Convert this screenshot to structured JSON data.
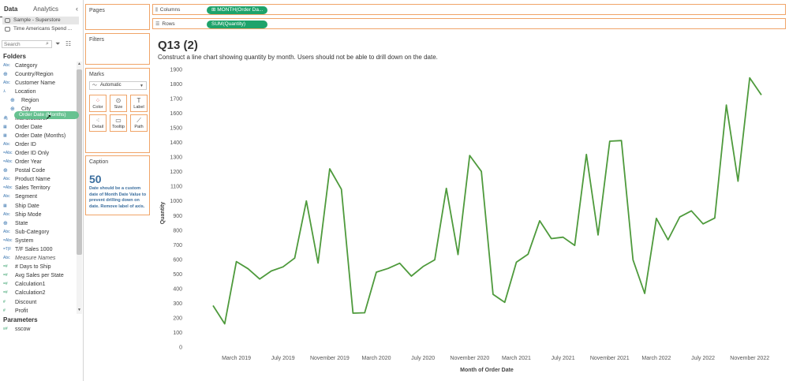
{
  "data_pane": {
    "tabs": [
      "Data",
      "Analytics"
    ],
    "datasources": [
      "Sample - Superstore",
      "Time Americans Spend ..."
    ],
    "search_placeholder": "Search",
    "folders_heading": "Folders",
    "fields": [
      {
        "name": "Category",
        "type": "Abc",
        "indent": false
      },
      {
        "name": "Country/Region",
        "type": "geo",
        "indent": false
      },
      {
        "name": "Customer Name",
        "type": "Abc",
        "indent": false
      },
      {
        "name": "Location",
        "type": "hier",
        "indent": false
      },
      {
        "name": "Region",
        "type": "geo",
        "indent": true
      },
      {
        "name": "City",
        "type": "geo",
        "indent": true
      },
      {
        "name": "Manufacturer",
        "type": "clip",
        "indent": false
      },
      {
        "name": "Order Date",
        "type": "date",
        "indent": false
      },
      {
        "name": "Order Date (Months)",
        "type": "date",
        "indent": false
      },
      {
        "name": "Order ID",
        "type": "Abc",
        "indent": false
      },
      {
        "name": "Order ID Only",
        "type": "=Abc",
        "indent": false
      },
      {
        "name": "Order Year",
        "type": "=Abc",
        "indent": false
      },
      {
        "name": "Postal Code",
        "type": "geo",
        "indent": false
      },
      {
        "name": "Product Name",
        "type": "Abc",
        "indent": false
      },
      {
        "name": "Sales Territory",
        "type": "=Abc",
        "indent": false
      },
      {
        "name": "Segment",
        "type": "Abc",
        "indent": false
      },
      {
        "name": "Ship Date",
        "type": "date",
        "indent": false
      },
      {
        "name": "Ship Mode",
        "type": "Abc",
        "indent": false
      },
      {
        "name": "State",
        "type": "geo",
        "indent": false
      },
      {
        "name": "Sub-Category",
        "type": "Abc",
        "indent": false
      },
      {
        "name": "System",
        "type": "=Abc",
        "indent": false
      },
      {
        "name": "T/F Sales 1000",
        "type": "=T|F",
        "indent": false
      },
      {
        "name": "Measure Names",
        "type": "Abc",
        "indent": false,
        "italic": true
      },
      {
        "name": "# Days to Ship",
        "type": "=#",
        "indent": false,
        "measure": true
      },
      {
        "name": "Avg Sales per State",
        "type": "=#",
        "indent": false,
        "measure": true
      },
      {
        "name": "Calculation1",
        "type": "=#",
        "indent": false,
        "measure": true
      },
      {
        "name": "Calculation2",
        "type": "=#",
        "indent": false,
        "measure": true
      },
      {
        "name": "Discount",
        "type": "#",
        "indent": false,
        "measure": true
      },
      {
        "name": "Profit",
        "type": "#",
        "indent": false,
        "measure": true
      }
    ],
    "parameters_heading": "Parameters",
    "parameters": [
      {
        "name": "sscow",
        "type": "#"
      }
    ]
  },
  "drag_pill": "Order Date (Months)",
  "cards": {
    "pages": "Pages",
    "filters": "Filters",
    "marks": "Marks",
    "marks_type": "Automatic",
    "mark_buttons": [
      "Color",
      "Size",
      "Label",
      "Detail",
      "Tooltip",
      "Path"
    ],
    "caption": "Caption",
    "caption_number": "50",
    "caption_text": "Date should be a custom date of Month Date Value to prevent drilling down on date.  Remove label of axis."
  },
  "shelves": {
    "columns_label": "Columns",
    "columns_pill": "MONTH(Order Da...",
    "rows_label": "Rows",
    "rows_pill": "SUM(Quantity)"
  },
  "viz": {
    "title": "Q13 (2)",
    "subtitle": "Construct a line chart showing quantity by month.  Users should not be able to drill down on the date."
  },
  "colors": {
    "line": "#4e9a3c",
    "pill": "#1ea36b",
    "shelf_border": "#f0a468",
    "caption": "#3b6e9e"
  },
  "chart_data": {
    "type": "line",
    "xlabel": "Month of Order Date",
    "ylabel": "Quantity",
    "ylim": [
      0,
      1900
    ],
    "yticks": [
      0,
      100,
      200,
      300,
      400,
      500,
      600,
      700,
      800,
      900,
      1000,
      1100,
      1200,
      1300,
      1400,
      1500,
      1600,
      1700,
      1800,
      1900
    ],
    "xtick_labels": [
      {
        "label": "March 2019",
        "index": 2
      },
      {
        "label": "July 2019",
        "index": 6
      },
      {
        "label": "November 2019",
        "index": 10
      },
      {
        "label": "March 2020",
        "index": 14
      },
      {
        "label": "July 2020",
        "index": 18
      },
      {
        "label": "November 2020",
        "index": 22
      },
      {
        "label": "March 2021",
        "index": 26
      },
      {
        "label": "July 2021",
        "index": 30
      },
      {
        "label": "November 2021",
        "index": 34
      },
      {
        "label": "March 2022",
        "index": 38
      },
      {
        "label": "July 2022",
        "index": 42
      },
      {
        "label": "November 2022",
        "index": 46
      }
    ],
    "series": [
      {
        "x": [
          "2019-01",
          "2019-02",
          "2019-03",
          "2019-04",
          "2019-05",
          "2019-06",
          "2019-07",
          "2019-08",
          "2019-09",
          "2019-10",
          "2019-11",
          "2019-12",
          "2020-01",
          "2020-02",
          "2020-03",
          "2020-04",
          "2020-05",
          "2020-06",
          "2020-07",
          "2020-08",
          "2020-09",
          "2020-10",
          "2020-11",
          "2020-12",
          "2021-01",
          "2021-02",
          "2021-03",
          "2021-04",
          "2021-05",
          "2021-06",
          "2021-07",
          "2021-08",
          "2021-09",
          "2021-10",
          "2021-11",
          "2021-12",
          "2022-01",
          "2022-02",
          "2022-03",
          "2022-04",
          "2022-05",
          "2022-06",
          "2022-07",
          "2022-08",
          "2022-09",
          "2022-10",
          "2022-11",
          "2022-12"
        ],
        "values": [
          284,
          159,
          585,
          536,
          466,
          521,
          549,
          609,
          1000,
          575,
          1220,
          1080,
          232,
          235,
          513,
          538,
          574,
          486,
          551,
          597,
          1086,
          633,
          1311,
          1202,
          361,
          306,
          581,
          636,
          864,
          742,
          752,
          696,
          1318,
          767,
          1409,
          1413,
          597,
          367,
          881,
          734,
          890,
          932,
          843,
          883,
          1656,
          1135,
          1842,
          1725
        ]
      }
    ]
  }
}
